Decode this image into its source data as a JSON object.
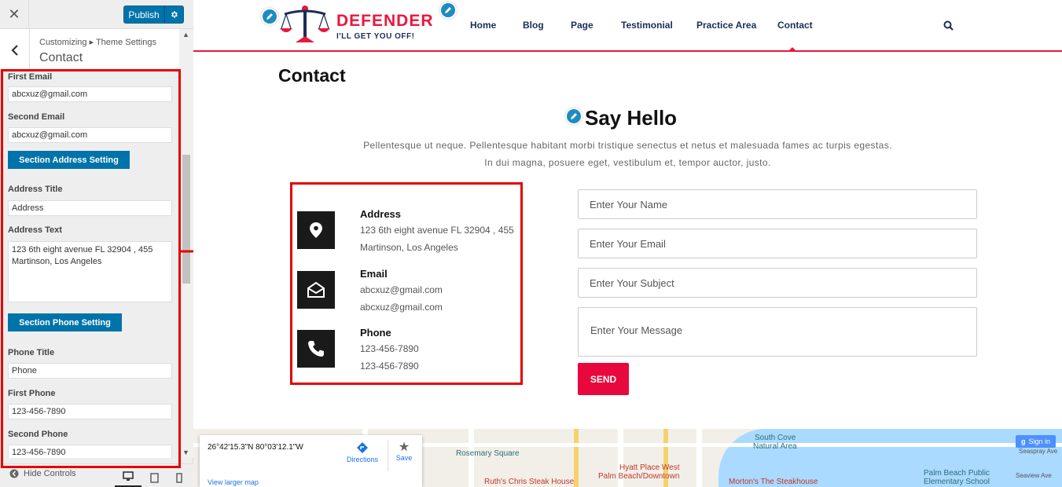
{
  "customizer": {
    "close_icon": "close-icon",
    "publish_label": "Publish",
    "breadcrumb": "Customizing ▸ Theme Settings",
    "section_title": "Contact",
    "fields": {
      "first_email_label": "First Email",
      "first_email_value": "abcxuz@gmail.com",
      "second_email_label": "Second Email",
      "second_email_value": "abcxuz@gmail.com",
      "address_section_button": "Section Address Setting",
      "address_title_label": "Address Title",
      "address_title_value": "Address",
      "address_text_label": "Address Text",
      "address_text_value": "123 6th eight avenue FL 32904 , 455 Martinson, Los Angeles",
      "phone_section_button": "Section Phone Setting",
      "phone_title_label": "Phone Title",
      "phone_title_value": "Phone",
      "first_phone_label": "First Phone",
      "first_phone_value": "123-456-7890",
      "second_phone_label": "Second Phone",
      "second_phone_value": "123-456-7890"
    },
    "footer": {
      "hide_controls": "Hide Controls"
    }
  },
  "site": {
    "logo_title": "DEFENDER",
    "logo_tagline": "I'LL GET YOU OFF!",
    "nav": [
      "Home",
      "Blog",
      "Page",
      "Testimonial",
      "Practice Area",
      "Contact"
    ],
    "active_nav": "Contact",
    "page_title": "Contact",
    "heading": "Say Hello",
    "intro": "Pellentesque ut neque. Pellentesque habitant morbi tristique senectus et netus et malesuada fames ac turpis egestas. In dui magna, posuere eget, vestibulum et, tempor auctor, justo.",
    "info": {
      "address_title": "Address",
      "address_line1": "123 6th eight avenue FL 32904 , 455",
      "address_line2": "Martinson, Los Angeles",
      "email_title": "Email",
      "email_line1": "abcxuz@gmail.com",
      "email_line2": "abcxuz@gmail.com",
      "phone_title": "Phone",
      "phone_line1": "123-456-7890",
      "phone_line2": "123-456-7890"
    },
    "form": {
      "name_placeholder": "Enter Your Name",
      "email_placeholder": "Enter Your Email",
      "subject_placeholder": "Enter Your Subject",
      "message_placeholder": "Enter Your Message",
      "send_label": "SEND"
    },
    "map": {
      "coords": "26°42'15.3\"N 80°03'12.1\"W",
      "directions": "Directions",
      "save": "Save",
      "larger_map": "View larger map",
      "sign_in": "Sign in",
      "labels": {
        "rosemary": "Rosemary Square",
        "ruths": "Ruth's Chris Steak House",
        "hyatt_1": "Hyatt Place West",
        "hyatt_2": "Palm Beach/Downtown",
        "mortons": "Morton's The Steakhouse",
        "southcove_1": "South Cove",
        "southcove_2": "Natural Area",
        "pbps_1": "Palm Beach Public",
        "pbps_2": "Elementary School",
        "seaspray": "Seaspray Ave",
        "seaview": "Seaview Ave"
      }
    }
  },
  "colors": {
    "brand_red": "#e8183c",
    "navy": "#1b2d57",
    "wp_blue": "#0073aa",
    "annotation_red": "#e60000"
  }
}
